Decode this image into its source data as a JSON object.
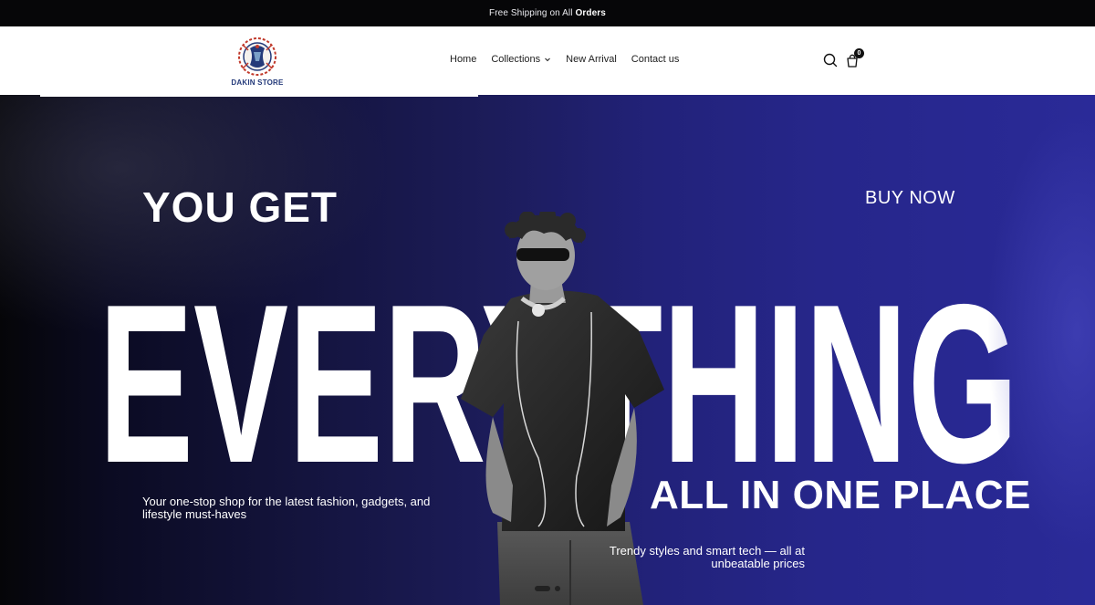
{
  "announcement": {
    "text": "Free Shipping on All",
    "bold": "Orders"
  },
  "brand": {
    "name": "DAKIN STORE",
    "colors": {
      "navy": "#243a7a",
      "accent": "#c0392b"
    }
  },
  "nav": {
    "items": [
      {
        "label": "Home"
      },
      {
        "label": "Collections",
        "has_dropdown": true
      },
      {
        "label": "New Arrival"
      },
      {
        "label": "Contact us"
      }
    ]
  },
  "header_icons": {
    "search": "search-icon",
    "cart": "shopping-bag-icon",
    "cart_count": "0"
  },
  "hero": {
    "headline_top": "YOU GET",
    "headline_big": "EVERYTHING",
    "headline_bottom": "ALL IN ONE PLACE",
    "cta": "BUY NOW",
    "tagline": "Your one-stop shop for the latest fashion, gadgets, and lifestyle must-haves",
    "subline": "Trendy styles and smart tech — all at unbeatable prices",
    "gradient_colors": [
      "#050508",
      "#1c1c5a",
      "#2a2a98"
    ],
    "slides": 2,
    "active_slide": 1
  }
}
